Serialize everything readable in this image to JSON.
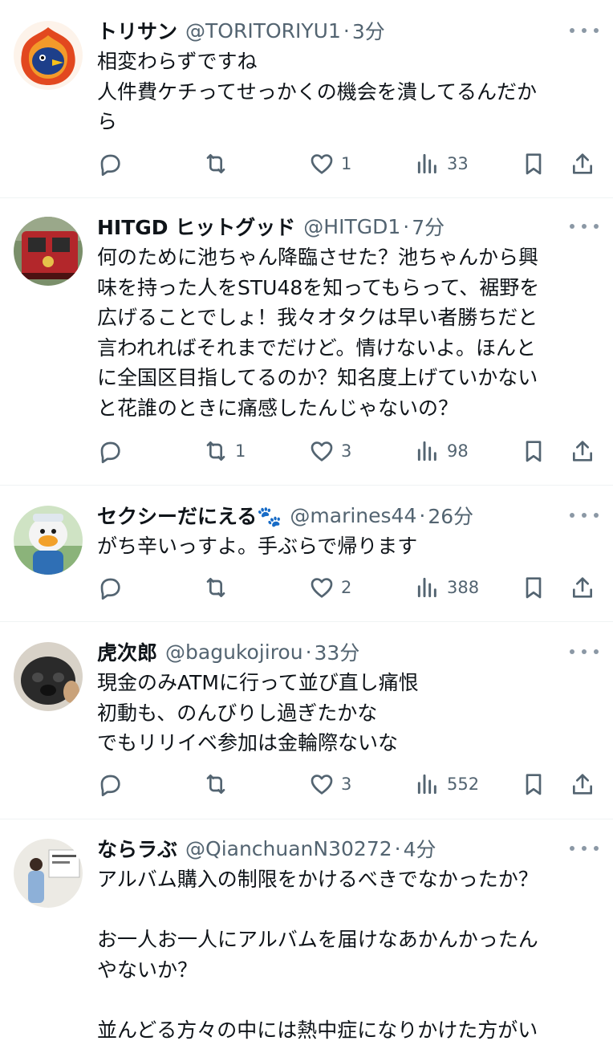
{
  "tweets": [
    {
      "name": "トリサン",
      "handle": "@TORITORIYU1",
      "time": "3分",
      "text": "相変わらずですね\n人件費ケチってせっかくの機会を潰してるんだか\nら",
      "reply": "",
      "retweet": "",
      "like": "1",
      "views": "33",
      "avatar_icon": "bird-flame-avatar"
    },
    {
      "name": "HITGD ヒットグッド",
      "handle": "@HITGD1",
      "time": "7分",
      "text": "何のために池ちゃん降臨させた？池ちゃんから興\n味を持った人をSTU48を知ってもらって、裾野を\n広げることでしょ！我々オタクは早い者勝ちだと\n言われればそれまでだけど。情けないよ。ほんと\nに全国区目指してるのか？知名度上げていかない\nと花誰のときに痛感したんじゃないの？",
      "reply": "",
      "retweet": "1",
      "like": "3",
      "views": "98",
      "avatar_icon": "train-avatar"
    },
    {
      "name": "セクシーだにえる🐾",
      "handle": "@marines44",
      "time": "26分",
      "text": "がち辛いっすよ。手ぶらで帰ります",
      "reply": "",
      "retweet": "",
      "like": "2",
      "views": "388",
      "avatar_icon": "duck-mascot-avatar"
    },
    {
      "name": "虎次郎",
      "handle": "@bagukojirou",
      "time": "33分",
      "text": "現金のみATMに行って並び直し痛恨\n初動も、のんびりし過ぎたかな\nでもリリイベ参加は金輪際ないな",
      "reply": "",
      "retweet": "",
      "like": "3",
      "views": "552",
      "avatar_icon": "pug-avatar"
    },
    {
      "name": "ならラぶ",
      "handle": "@QianchuanN30272",
      "time": "4分",
      "text": "アルバム購入の制限をかけるべきでなかったか？\n\nお一人お一人にアルバムを届けなあかんかったん\nやないか？\n\n並んどる方々の中には熱中症になりかけた方がい",
      "reply": "",
      "retweet": "",
      "like": "",
      "views": "",
      "avatar_icon": "person-photo-avatar"
    }
  ],
  "separator": "·",
  "colors": {
    "text": "#0f1419",
    "muted": "#536471",
    "divider": "#eff3f4"
  }
}
